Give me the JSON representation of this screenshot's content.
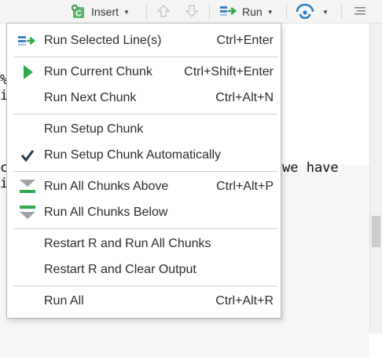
{
  "toolbar": {
    "insert_label": "Insert",
    "run_label": "Run",
    "icons": [
      "insert-chunk-icon",
      "arrow-up-icon",
      "arrow-down-icon",
      "run-icon",
      "publish-icon",
      "outline-icon"
    ],
    "colors": {
      "accent_green": "#2fa84f",
      "accent_blue": "#2a7fc9"
    }
  },
  "editor": {
    "partial_lines": [
      "%",
      "i",
      "c",
      "i"
    ],
    "partial_right_text": "we have"
  },
  "menu": {
    "items": [
      {
        "label": "Run Selected Line(s)",
        "shortcut": "Ctrl+Enter",
        "icon": "run-lines-icon"
      },
      {
        "label": "Run Current Chunk",
        "shortcut": "Ctrl+Shift+Enter",
        "icon": "play-icon"
      },
      {
        "label": "Run Next Chunk",
        "shortcut": "Ctrl+Alt+N",
        "icon": ""
      },
      {
        "label": "Run Setup Chunk",
        "shortcut": "",
        "icon": ""
      },
      {
        "label": "Run Setup Chunk Automatically",
        "shortcut": "",
        "icon": "checkmark-icon",
        "checked": true
      },
      {
        "label": "Run All Chunks Above",
        "shortcut": "Ctrl+Alt+P",
        "icon": "run-above-icon"
      },
      {
        "label": "Run All Chunks Below",
        "shortcut": "",
        "icon": "run-below-icon"
      },
      {
        "label": "Restart R and Run All Chunks",
        "shortcut": "",
        "icon": ""
      },
      {
        "label": "Restart R and Clear Output",
        "shortcut": "",
        "icon": ""
      },
      {
        "label": "Run All",
        "shortcut": "Ctrl+Alt+R",
        "icon": ""
      }
    ]
  }
}
